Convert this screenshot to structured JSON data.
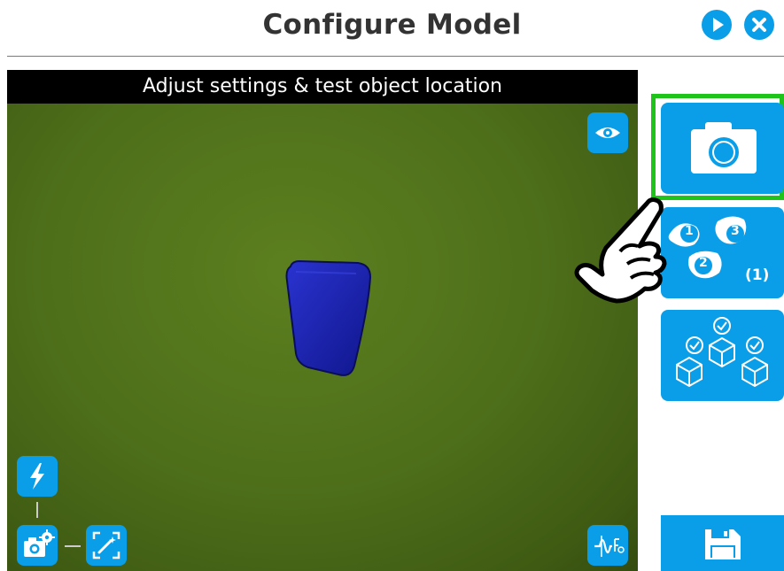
{
  "header": {
    "title": "Configure Model"
  },
  "viewport": {
    "caption": "Adjust settings & test object location",
    "object_color": "#1a22b8"
  },
  "side_panel": {
    "capture_button": {
      "icon": "camera-icon"
    },
    "feature_selection": {
      "icon": "numbered-features-icon",
      "numbers": [
        "1",
        "2",
        "3"
      ],
      "count": "(1)"
    },
    "test_locate": {
      "icon": "check-cubes-icon"
    },
    "save_button": {
      "icon": "floppy-disk-icon"
    }
  },
  "colors": {
    "accent": "#0a9ee8",
    "highlight": "#1ec41a",
    "title_text": "#333333"
  }
}
